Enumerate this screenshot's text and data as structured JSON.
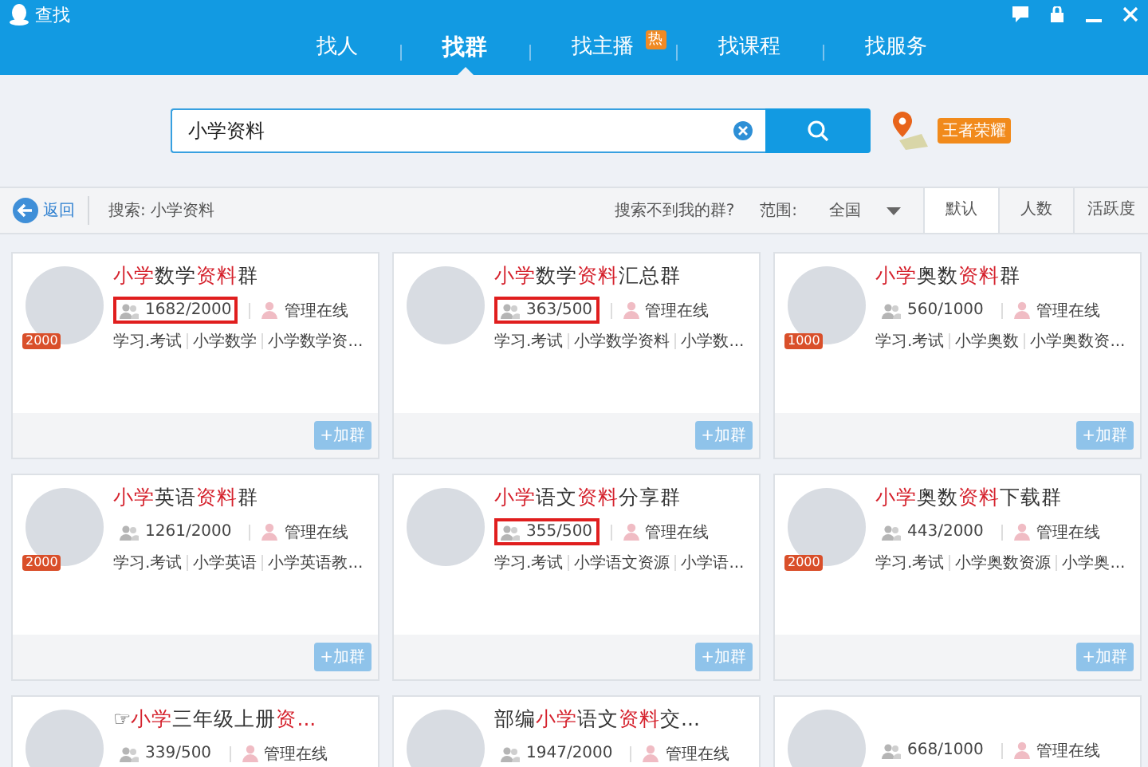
{
  "window": {
    "title": "查找"
  },
  "tabs": [
    {
      "label": "找人",
      "selected": false
    },
    {
      "label": "找群",
      "selected": true
    },
    {
      "label": "找主播",
      "selected": false,
      "badge": "热"
    },
    {
      "label": "找课程",
      "selected": false
    },
    {
      "label": "找服务",
      "selected": false
    }
  ],
  "search": {
    "value": "小学资料",
    "tag": "王者荣耀"
  },
  "toolbar": {
    "back": "返回",
    "query": "搜索: 小学资料",
    "help": "搜索不到我的群?",
    "range_label": "范围:",
    "range": "全国",
    "sorts": [
      {
        "label": "默认",
        "selected": true
      },
      {
        "label": "人数",
        "selected": false
      },
      {
        "label": "活跃度",
        "selected": false
      }
    ]
  },
  "cards": [
    {
      "title": [
        {
          "text": "小学",
          "hit": true
        },
        {
          "text": "数学",
          "hit": false
        },
        {
          "text": "资料",
          "hit": true
        },
        {
          "text": "群",
          "hit": false
        }
      ],
      "badge": "2000",
      "members": "1682/2000",
      "admin": "管理在线",
      "marked": true,
      "tags": [
        "学习.考试",
        "小学数学",
        "小学数学资..."
      ],
      "join": "+加群"
    },
    {
      "title": [
        {
          "text": "小学",
          "hit": true
        },
        {
          "text": "数学",
          "hit": false
        },
        {
          "text": "资料",
          "hit": true
        },
        {
          "text": "汇总群",
          "hit": false
        }
      ],
      "members": "363/500",
      "admin": "管理在线",
      "marked": true,
      "tags": [
        "学习.考试",
        "小学数学资料",
        "小学数..."
      ],
      "join": "+加群"
    },
    {
      "title": [
        {
          "text": "小学",
          "hit": true
        },
        {
          "text": "奥数",
          "hit": false
        },
        {
          "text": "资料",
          "hit": true
        },
        {
          "text": "群",
          "hit": false
        }
      ],
      "badge": "1000",
      "members": "560/1000",
      "admin": "管理在线",
      "marked": false,
      "tags": [
        "学习.考试",
        "小学奥数",
        "小学奥数资..."
      ],
      "join": "+加群"
    },
    {
      "title": [
        {
          "text": "小学",
          "hit": true
        },
        {
          "text": "英语",
          "hit": false
        },
        {
          "text": "资料",
          "hit": true
        },
        {
          "text": "群",
          "hit": false
        }
      ],
      "badge": "2000",
      "members": "1261/2000",
      "admin": "管理在线",
      "marked": false,
      "tags": [
        "学习.考试",
        "小学英语",
        "小学英语教..."
      ],
      "join": "+加群"
    },
    {
      "title": [
        {
          "text": "小学",
          "hit": true
        },
        {
          "text": "语文",
          "hit": false
        },
        {
          "text": "资料",
          "hit": true
        },
        {
          "text": "分享群",
          "hit": false
        }
      ],
      "members": "355/500",
      "admin": "管理在线",
      "marked": true,
      "tags": [
        "学习.考试",
        "小学语文资源",
        "小学语..."
      ],
      "join": "+加群"
    },
    {
      "title": [
        {
          "text": "小学",
          "hit": true
        },
        {
          "text": "奥数",
          "hit": false
        },
        {
          "text": "资料",
          "hit": true
        },
        {
          "text": "下载群",
          "hit": false
        }
      ],
      "badge": "2000",
      "members": "443/2000",
      "admin": "管理在线",
      "marked": false,
      "tags": [
        "学习.考试",
        "小学奥数资源",
        "小学奥..."
      ],
      "join": "+加群"
    },
    {
      "title": [
        {
          "text": "☞",
          "hit": false
        },
        {
          "text": "小学",
          "hit": true
        },
        {
          "text": "三年级上册",
          "hit": false
        },
        {
          "text": "资...",
          "hit": true
        }
      ],
      "members": "339/500",
      "admin": "管理在线",
      "marked": false
    },
    {
      "title": [
        {
          "text": "部编",
          "hit": false
        },
        {
          "text": "小学",
          "hit": true
        },
        {
          "text": "语文",
          "hit": false
        },
        {
          "text": "资料",
          "hit": true
        },
        {
          "text": "交...",
          "hit": false
        }
      ],
      "members": "1947/2000",
      "admin": "管理在线",
      "marked": false
    },
    {
      "members": "668/1000",
      "admin": "管理在线",
      "marked": false
    }
  ]
}
